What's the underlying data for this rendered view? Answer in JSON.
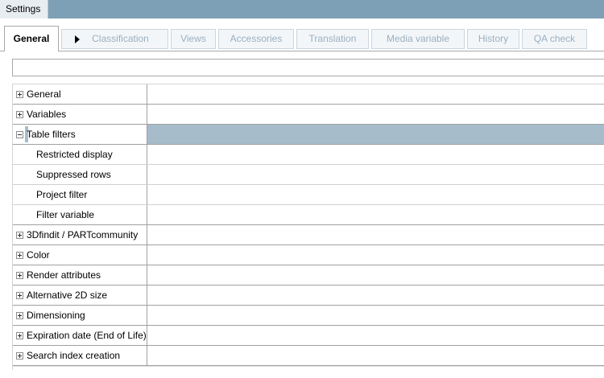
{
  "window": {
    "title": "Settings"
  },
  "tabs": [
    {
      "label": "General",
      "active": true
    },
    {
      "label": "Classification",
      "has_arrow": true
    },
    {
      "label": "Views"
    },
    {
      "label": "Accessories"
    },
    {
      "label": "Translation"
    },
    {
      "label": "Media variable"
    },
    {
      "label": "History"
    },
    {
      "label": "QA check"
    }
  ],
  "search": {
    "value": ""
  },
  "tree": [
    {
      "label": "General",
      "type": "group",
      "expanded": false
    },
    {
      "label": "Variables",
      "type": "group",
      "expanded": false
    },
    {
      "label": "Table filters",
      "type": "group",
      "expanded": true,
      "selected": true
    },
    {
      "label": "Restricted display",
      "type": "child"
    },
    {
      "label": "Suppressed rows",
      "type": "child"
    },
    {
      "label": "Project filter",
      "type": "child"
    },
    {
      "label": "Filter variable",
      "type": "child"
    },
    {
      "label": "3Dfindit / PARTcommunity",
      "type": "group",
      "expanded": false
    },
    {
      "label": "Color",
      "type": "group",
      "expanded": false
    },
    {
      "label": "Render attributes",
      "type": "group",
      "expanded": false
    },
    {
      "label": "Alternative 2D size",
      "type": "group",
      "expanded": false
    },
    {
      "label": "Dimensioning",
      "type": "group",
      "expanded": false
    },
    {
      "label": "Expiration date (End of Life)",
      "type": "group",
      "expanded": false
    },
    {
      "label": "Search index creation",
      "type": "group",
      "expanded": false
    }
  ],
  "colors": {
    "titlebar": "#7ea0b6",
    "selection": "#a7bccb",
    "inactive_tab_text": "#9ab0c0"
  }
}
